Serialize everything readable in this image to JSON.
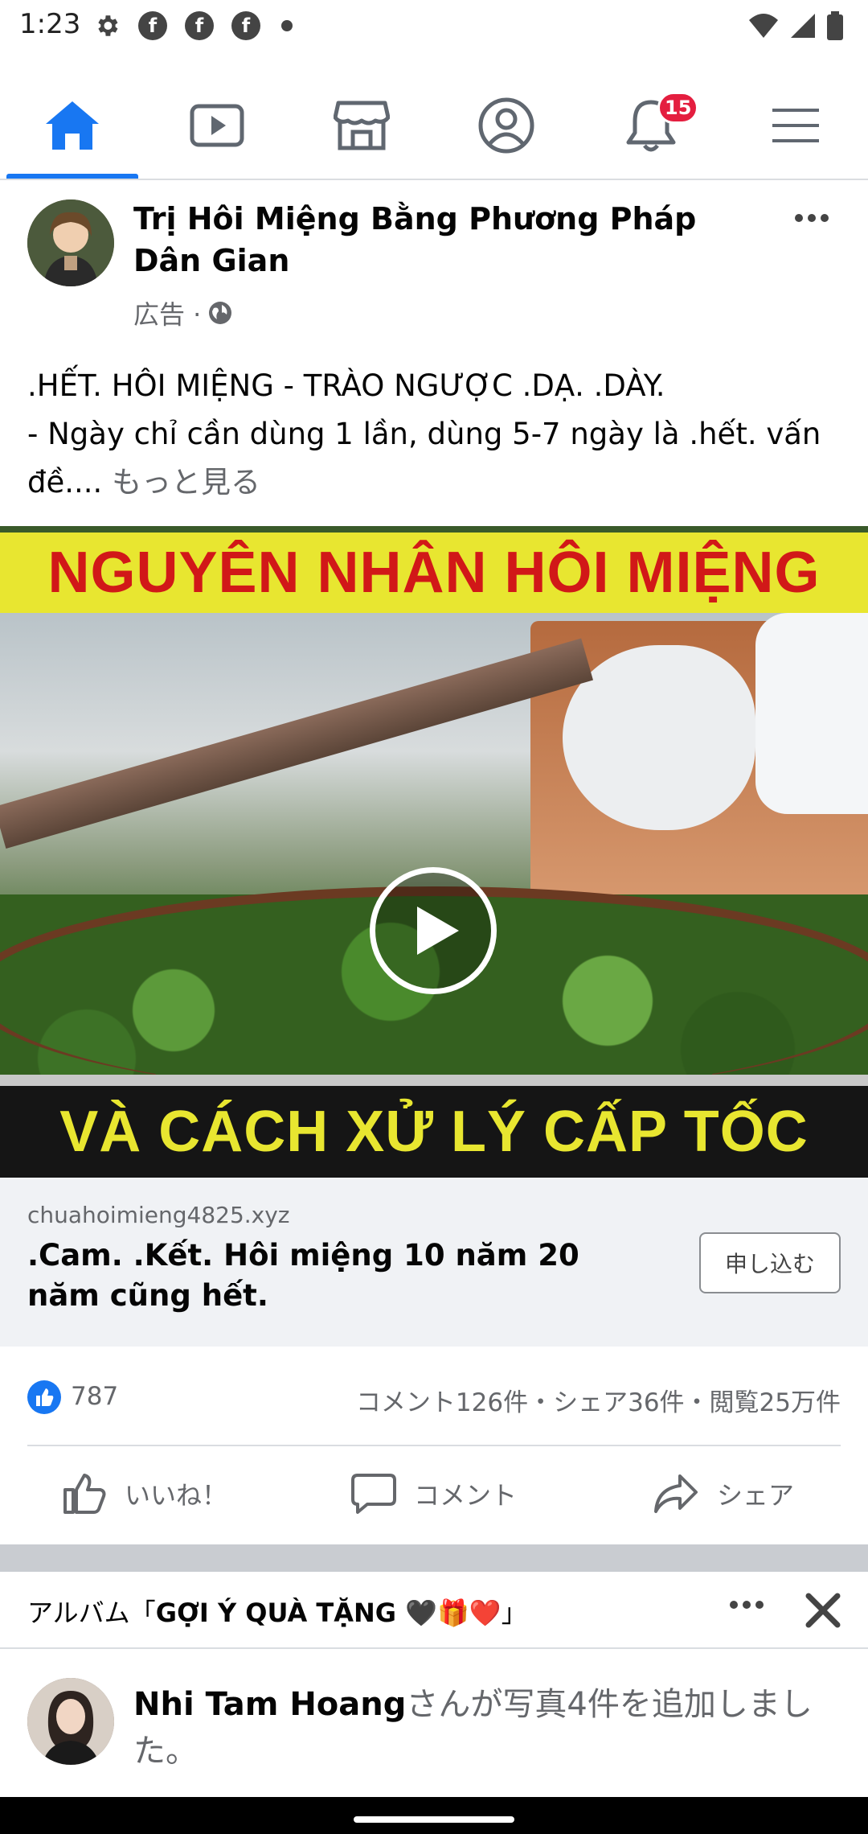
{
  "status_bar": {
    "time": "1:23",
    "fb_icon_letter": "f"
  },
  "nav": {
    "tabs": [
      {
        "name": "home",
        "active": true
      },
      {
        "name": "watch",
        "active": false
      },
      {
        "name": "marketplace",
        "active": false
      },
      {
        "name": "profile",
        "active": false
      },
      {
        "name": "notifications",
        "active": false,
        "badge": "15"
      },
      {
        "name": "menu",
        "active": false
      }
    ],
    "accent": "#1877f2",
    "badge_color": "#e41e3f"
  },
  "post": {
    "title": "Trị Hôi Miệng Bằng Phương Pháp Dân Gian",
    "meta": "広告 ·",
    "text_line1": ".HẾT. HÔI MIỆNG - TRÀO NGƯỢC .DẠ. .DÀY.",
    "text_line2": "- Ngày chỉ cần dùng 1 lần, dùng 5-7 ngày là .hết. vấn đề....",
    "see_more": "もっと見る",
    "banner_top": "NGUYÊN NHÂN HÔI MIỆNG",
    "banner_bottom": "VÀ CÁCH XỬ LÝ CẤP TỐC",
    "link_domain": "chuahoimieng4825.xyz",
    "link_title": ".Cam. .Kết. Hôi miệng 10 năm 20 năm cũng hết.",
    "cta_label": "申し込む",
    "like_count": "787",
    "stats": "コメント126件・シェア36件・閲覧25万件",
    "actions": {
      "like": "いいね！",
      "comment": "コメント",
      "share": "シェア"
    }
  },
  "album": {
    "prefix": "アルバム「",
    "name": "GỢI Ý QUÀ TẶNG 🖤🎁❤️",
    "suffix": "」"
  },
  "activity": {
    "user": "Nhi Tam Hoang",
    "text": "さんが写真4件を追加しました。"
  }
}
